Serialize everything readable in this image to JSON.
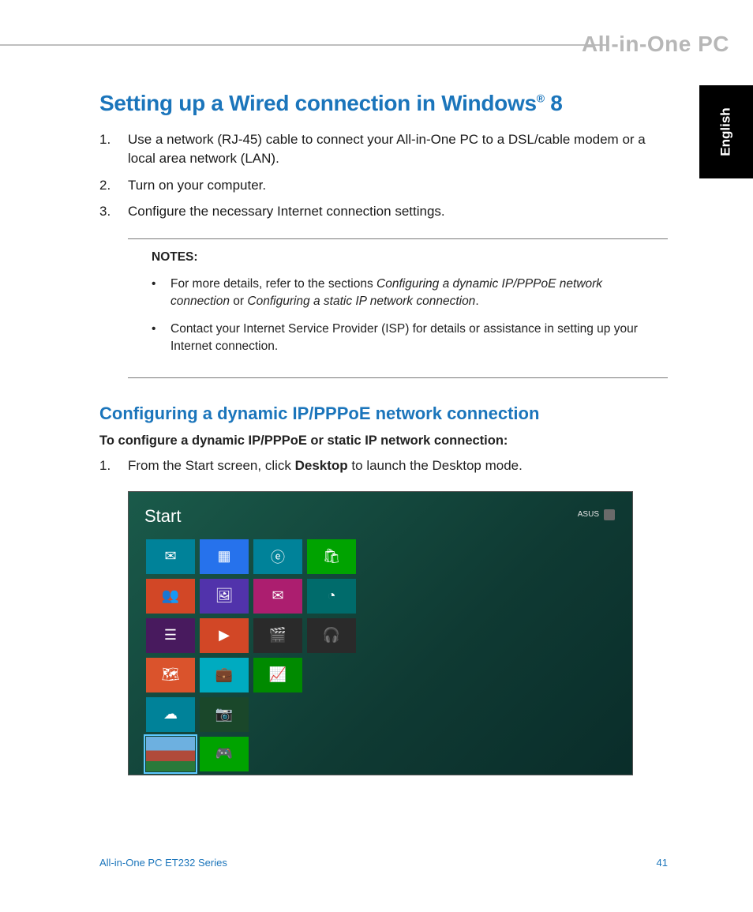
{
  "header": {
    "brand": "All-in-One PC",
    "language_tab": "English"
  },
  "main": {
    "title_prefix": "Setting up a Wired connection in Windows",
    "title_suffix": " 8",
    "steps": [
      {
        "n": "1.",
        "text": "Use a network (RJ-45) cable to connect your All-in-One PC to a DSL/cable modem or a local area network (LAN)."
      },
      {
        "n": "2.",
        "text": "Turn on your computer."
      },
      {
        "n": "3.",
        "text": "Configure the necessary Internet connection settings."
      }
    ],
    "notes": {
      "label": "NOTES:",
      "items": [
        {
          "pre": "For more details, refer to the sections ",
          "em1": "Configuring a dynamic IP/PPPoE network connection",
          "mid": " or ",
          "em2": "Configuring a static IP network connection",
          "post": "."
        },
        {
          "pre": "Contact your Internet Service Provider (ISP) for details or assistance in setting up your Internet connection.",
          "em1": "",
          "mid": "",
          "em2": "",
          "post": ""
        }
      ]
    },
    "subsection": {
      "title": "Configuring a dynamic IP/PPPoE network connection",
      "lead": "To configure a dynamic IP/PPPoE or static IP network connection:",
      "step1_n": "1.",
      "step1_pre": "From the Start screen, click ",
      "step1_bold": "Desktop",
      "step1_post": " to launch the Desktop mode."
    }
  },
  "start_screen": {
    "label": "Start",
    "user": "ASUS",
    "tiles": [
      {
        "icon": "✉",
        "color": "c-teal"
      },
      {
        "icon": "▦",
        "color": "c-blue"
      },
      {
        "icon": "ⓔ",
        "color": "c-teal"
      },
      {
        "icon": "🛍",
        "color": "c-lgreen"
      },
      {
        "icon": "",
        "color": ""
      },
      {
        "icon": "👥",
        "color": "c-red"
      },
      {
        "icon": "🖼",
        "color": "c-purple"
      },
      {
        "icon": "✉",
        "color": "c-mag"
      },
      {
        "icon": "◔",
        "color": "c-dkteal"
      },
      {
        "icon": "",
        "color": ""
      },
      {
        "icon": "☰",
        "color": "c-dkpurp"
      },
      {
        "icon": "▶",
        "color": "c-red"
      },
      {
        "icon": "🎬",
        "color": "c-dark"
      },
      {
        "icon": "🎧",
        "color": "c-dark"
      },
      {
        "icon": "",
        "color": ""
      },
      {
        "icon": "🗺",
        "color": "c-orange"
      },
      {
        "icon": "💼",
        "color": "c-turq"
      },
      {
        "icon": "📈",
        "color": "c-green"
      },
      {
        "icon": "",
        "color": ""
      },
      {
        "icon": "",
        "color": ""
      },
      {
        "icon": "☁",
        "color": "c-teal"
      },
      {
        "icon": "📷",
        "color": "c-dkgrn"
      },
      {
        "icon": "",
        "color": ""
      },
      {
        "icon": "",
        "color": ""
      },
      {
        "icon": "",
        "color": ""
      },
      {
        "icon": "",
        "color": "c-photo",
        "selected": true
      },
      {
        "icon": "🎮",
        "color": "c-lgreen"
      }
    ]
  },
  "footer": {
    "series": "All-in-One PC ET232 Series",
    "page": "41"
  }
}
